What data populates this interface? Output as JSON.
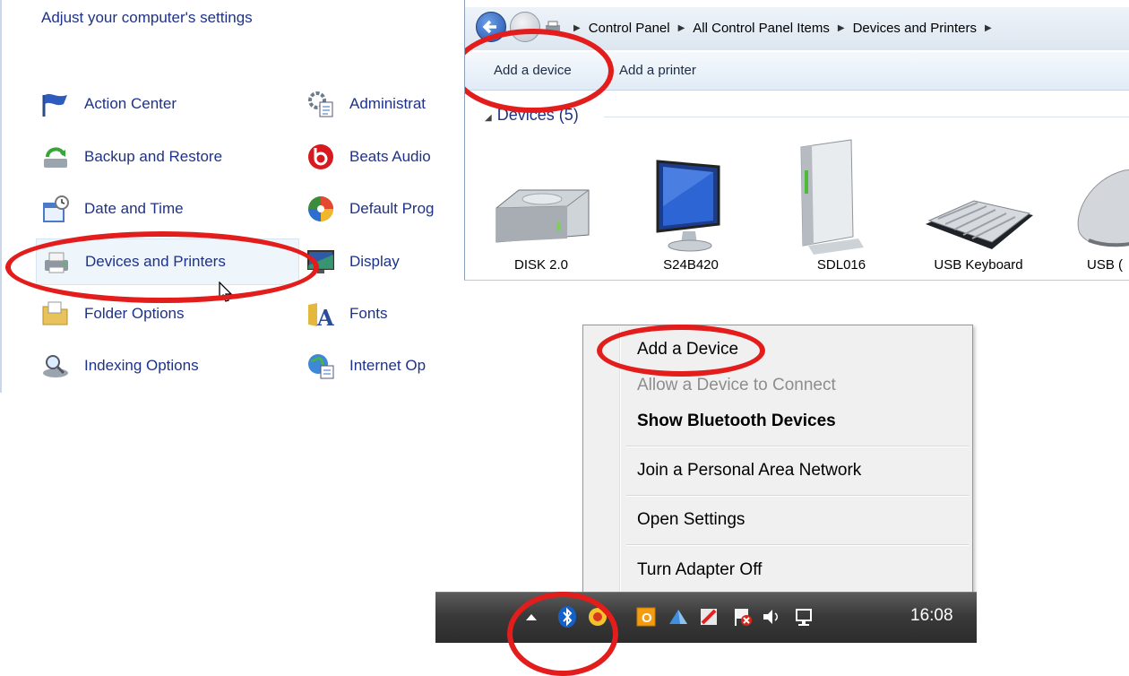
{
  "control_panel": {
    "title": "Adjust your computer's settings",
    "left_items": [
      {
        "label": "Action Center",
        "icon": "flag-icon"
      },
      {
        "label": "Backup and Restore",
        "icon": "backup-icon"
      },
      {
        "label": "Date and Time",
        "icon": "calendar-clock-icon"
      },
      {
        "label": "Devices and Printers",
        "icon": "printer-icon"
      },
      {
        "label": "Folder Options",
        "icon": "folder-icon"
      },
      {
        "label": "Indexing Options",
        "icon": "magnifier-icon"
      }
    ],
    "right_items": [
      {
        "label": "Administrat",
        "icon": "admin-tools-icon"
      },
      {
        "label": "Beats Audio",
        "icon": "beats-icon"
      },
      {
        "label": "Default Prog",
        "icon": "default-programs-icon"
      },
      {
        "label": "Display",
        "icon": "monitor-icon"
      },
      {
        "label": "Fonts",
        "icon": "fonts-icon"
      },
      {
        "label": "Internet Op",
        "icon": "globe-icon"
      }
    ]
  },
  "explorer": {
    "breadcrumb": [
      "Control Panel",
      "All Control Panel Items",
      "Devices and Printers"
    ],
    "commands": {
      "add_device": "Add a device",
      "add_printer": "Add a printer"
    },
    "group_label": "Devices (5)",
    "devices": [
      {
        "name": "DISK 2.0",
        "icon": "drive-icon"
      },
      {
        "name": "S24B420",
        "icon": "monitor-icon"
      },
      {
        "name": "SDL016",
        "icon": "tower-drive-icon"
      },
      {
        "name": "USB Keyboard",
        "icon": "keyboard-icon"
      },
      {
        "name": "USB (",
        "icon": "mouse-icon"
      }
    ]
  },
  "bluetooth_menu": {
    "items": [
      {
        "label": "Add a Device",
        "state": "normal"
      },
      {
        "label": "Allow a Device to Connect",
        "state": "disabled"
      },
      {
        "label": "Show Bluetooth Devices",
        "state": "bold"
      },
      {
        "label": "Join a Personal Area Network",
        "state": "normal"
      },
      {
        "label": "Open Settings",
        "state": "normal"
      },
      {
        "label": "Turn Adapter Off",
        "state": "normal"
      }
    ]
  },
  "taskbar": {
    "clock": "16:08",
    "tray_icons": [
      "show-hidden-icon",
      "bluetooth-icon",
      "security-icon",
      "office-icon",
      "network-app-icon",
      "tool-icon",
      "action-center-flag-icon",
      "speaker-icon",
      "network-icon"
    ]
  },
  "annotation_color": "#e31c1c"
}
